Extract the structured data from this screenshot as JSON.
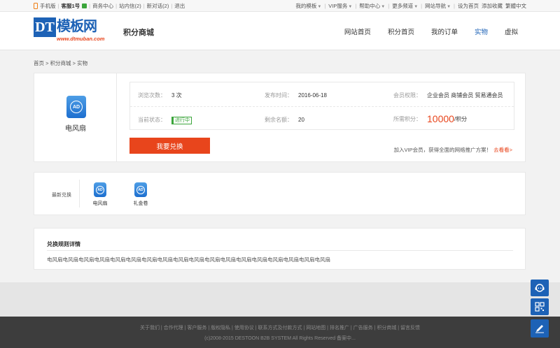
{
  "topbar": {
    "mobile": "手机版",
    "user": "客服1号",
    "links": [
      "商务中心",
      "站内信(2)",
      "新对话(2)",
      "退出"
    ],
    "right": [
      "我的模板",
      "VIP服务",
      "帮助中心",
      "更多频道",
      "网站导航",
      "设为首页",
      "添加收藏",
      "繁體中文"
    ]
  },
  "header": {
    "logo_text": "DT",
    "logo_cn": "模板网",
    "logo_url": "www.dtmuban.com",
    "site_title": "积分商城",
    "nav": [
      "网站首页",
      "积分首页",
      "我的订单",
      "实物",
      "虚拟"
    ]
  },
  "breadcrumb": "首页 > 积分商城 > 实物",
  "product": {
    "icon_text": "AD",
    "name": "电风扇",
    "views_label": "浏览次数：",
    "views_value": "3 次",
    "date_label": "发布时间：",
    "date_value": "2016-06-18",
    "member_label": "会员权限：",
    "member_value": "企业会员 商铺会员 贸易通会员",
    "status_label": "当前状态：",
    "status_value": "进行中",
    "remaining_label": "剩余名额：",
    "remaining_value": "20",
    "points_label": "所需积分：",
    "points_value": "10000",
    "points_unit": "/积分",
    "redeem_button": "我要兑换",
    "vip_note": "加入VIP会员，获得全面的网络推广方案！",
    "vip_link": "去看看>"
  },
  "recent": {
    "label": "最新兑换",
    "items": [
      {
        "name": "电风扇",
        "icon": "AD"
      },
      {
        "name": "礼金卷",
        "icon": "AD"
      }
    ]
  },
  "rules": {
    "title": "兑换规则详情",
    "text": "电风扇电风扇电风扇电风扇电风扇电风扇电风扇电风扇电风扇电风扇电风扇电风扇电风扇电风扇电风扇电风扇电风扇电风扇"
  },
  "footer": {
    "links": "关于我们 | 合作代理 | 客户服务 | 版权隐私 | 使用协议 | 联系方式及付款方式 | 网站地图 | 排名推广 | 广告服务 | 积分商城 | 留言反馈",
    "copyright": "(c)2008-2015 DESTOON B2B SYSTEM All Rights Reserved 备案中..."
  },
  "colors": {
    "brand": "#1d62b6",
    "accent": "#e8451c",
    "status": "#3ba53b"
  }
}
